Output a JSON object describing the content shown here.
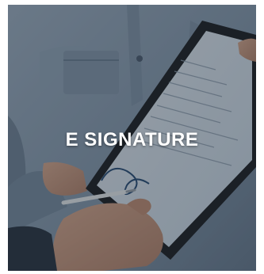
{
  "banner": {
    "title": "E SIGNATURE"
  },
  "colors": {
    "shirt": "#8fa3b8",
    "shirt_shadow": "#5d7085",
    "tablet_frame": "#1f2328",
    "tablet_screen": "#d9e6f2",
    "skin": "#c89a82",
    "overlay": "#141c26",
    "title_text": "#ffffff"
  },
  "icons": {
    "photo": "person-signing-tablet-photo"
  }
}
